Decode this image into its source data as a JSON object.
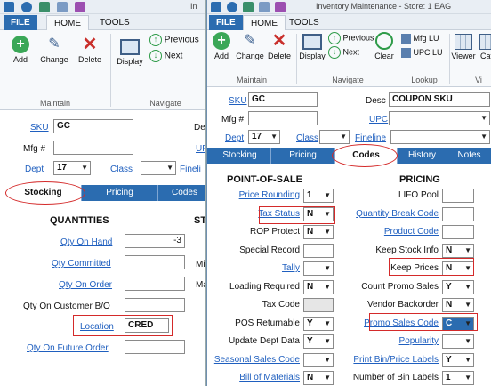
{
  "ribbon": {
    "file": "FILE",
    "home": "HOME",
    "tools": "TOOLS",
    "add": "Add",
    "change": "Change",
    "delete": "Delete",
    "display": "Display",
    "previous": "Previous",
    "next": "Next",
    "clear": "Clear",
    "mfg_lu": "Mfg LU",
    "upc_lu": "UPC LU",
    "viewer": "Viewer",
    "cat_partial": "Cat",
    "group_maintain": "Maintain",
    "group_navigate": "Navigate",
    "group_lookup": "Lookup",
    "group_vi_partial": "Vi"
  },
  "back_window": {
    "title_partial": "In",
    "sku_label": "SKU",
    "sku_value": "GC",
    "mfg_label": "Mfg #",
    "mfg_value": "",
    "dept_label": "Dept",
    "dept_value": "17",
    "class_label": "Class",
    "class_value": "",
    "de_partial": "De",
    "up_partial": "UP",
    "fineli_partial": "Fineli",
    "tabs": [
      "Stocking",
      "Pricing",
      "Codes"
    ],
    "quantities_header": "QUANTITIES",
    "st_partial": "ST",
    "mi_partial": "Mi",
    "ma_partial": "Ma",
    "qty_on_hand_label": "Qty On Hand",
    "qty_on_hand_value": "-3",
    "qty_committed_label": "Qty Committed",
    "qty_committed_value": "",
    "qty_on_order_label": "Qty On Order",
    "qty_on_order_value": "",
    "qty_customer_bo_label": "Qty On Customer B/O",
    "qty_customer_bo_value": "",
    "location_label": "Location",
    "location_value": "CRED",
    "qty_future_order_label": "Qty On Future Order",
    "qty_future_order_value": ""
  },
  "front_window": {
    "title": "Inventory Maintenance - Store: 1 EAG",
    "sku_label": "SKU",
    "sku_value": "GC",
    "desc_label": "Desc",
    "desc_value": "COUPON SKU",
    "mfg_label": "Mfg #",
    "mfg_value": "",
    "upc_label": "UPC",
    "upc_value": "",
    "dept_label": "Dept",
    "dept_value": "17",
    "class_label": "Class",
    "class_value": "",
    "fineline_label": "Fineline",
    "fineline_value": "",
    "tabs": [
      "Stocking",
      "Pricing",
      "Codes",
      "History",
      "Notes"
    ],
    "pos_header": "POINT-OF-SALE",
    "pricing_header": "PRICING",
    "pos_rows": [
      {
        "label": "Price Rounding",
        "value": "1",
        "link": true
      },
      {
        "label": "Tax Status",
        "value": "N",
        "link": true
      },
      {
        "label": "ROP Protect",
        "value": "N",
        "link": false
      },
      {
        "label": "Special Record",
        "value": "",
        "link": false
      },
      {
        "label": "Tally",
        "value": "",
        "link": true
      },
      {
        "label": "Loading Required",
        "value": "N",
        "link": false
      },
      {
        "label": "Tax Code",
        "value": "",
        "link": false
      },
      {
        "label": "POS Returnable",
        "value": "Y",
        "link": false
      },
      {
        "label": "Update Dept Data",
        "value": "Y",
        "link": false
      },
      {
        "label": "Seasonal Sales Code",
        "value": "",
        "link": true
      },
      {
        "label": "Bill of Materials",
        "value": "N",
        "link": true
      }
    ],
    "pricing_rows": [
      {
        "label": "LIFO Pool",
        "value": "",
        "link": false
      },
      {
        "label": "Quantity Break Code",
        "value": "",
        "link": true
      },
      {
        "label": "Product Code",
        "value": "",
        "link": true
      },
      {
        "label": "Keep Stock Info",
        "value": "N",
        "link": false
      },
      {
        "label": "Keep Prices",
        "value": "N",
        "link": false
      },
      {
        "label": "Count Promo Sales",
        "value": "Y",
        "link": false
      },
      {
        "label": "Vendor Backorder",
        "value": "N",
        "link": false
      },
      {
        "label": "Promo Sales Code",
        "value": "C",
        "link": true
      },
      {
        "label": "Popularity",
        "value": "",
        "link": true
      },
      {
        "label": "Print Bin/Price Labels",
        "value": "Y",
        "link": true
      },
      {
        "label": "Number of Bin Labels",
        "value": "1",
        "link": false
      }
    ]
  },
  "colors": {
    "accent": "#2b6cb0",
    "highlight": "#d42a2a",
    "link": "#1f5fbf"
  }
}
